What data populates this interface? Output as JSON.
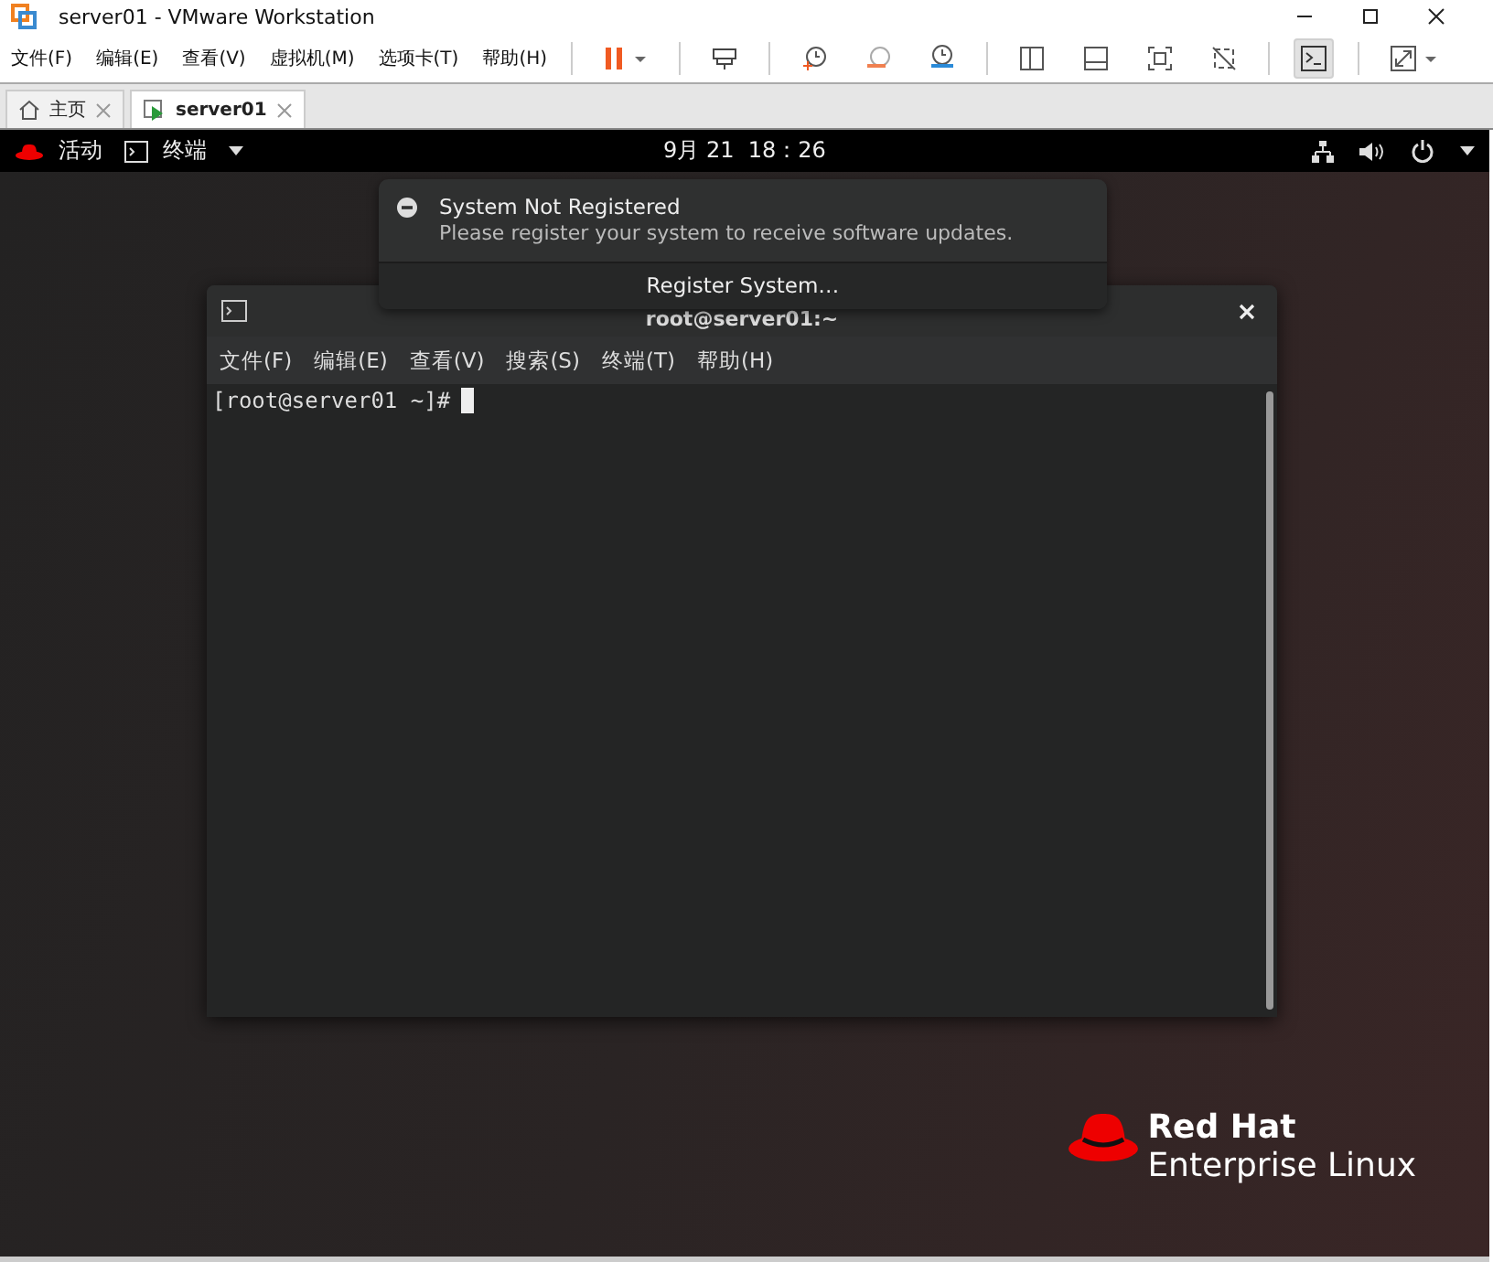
{
  "window": {
    "title": "server01 - VMware Workstation"
  },
  "menu": [
    "文件(F)",
    "编辑(E)",
    "查看(V)",
    "虚拟机(M)",
    "选项卡(T)",
    "帮助(H)"
  ],
  "toolbar": [
    {
      "kind": "pause",
      "selected": false
    },
    {
      "kind": "send-keys",
      "selected": false
    },
    {
      "kind": "snapshot",
      "selected": false
    },
    {
      "kind": "revert",
      "selected": false
    },
    {
      "kind": "manage",
      "selected": false
    },
    {
      "kind": "sidebar",
      "selected": false
    },
    {
      "kind": "thumbnail",
      "selected": false
    },
    {
      "kind": "fit",
      "selected": false
    },
    {
      "kind": "nofit",
      "selected": false
    },
    {
      "kind": "console",
      "selected": true
    },
    {
      "kind": "fullscreen",
      "selected": false
    }
  ],
  "tabs": [
    {
      "label": "主页",
      "kind": "home",
      "selected": false
    },
    {
      "label": "server01",
      "kind": "vm",
      "selected": true
    }
  ],
  "gnome_bar": {
    "activities": "活动",
    "app": "终端",
    "clock": "9月 21  18：26"
  },
  "notification": {
    "title": "System Not Registered",
    "body": "Please register your system to receive software updates.",
    "action": "Register System…"
  },
  "terminal": {
    "title": "root@server01:~",
    "menu": [
      "文件(F)",
      "编辑(E)",
      "查看(V)",
      "搜索(S)",
      "终端(T)",
      "帮助(H)"
    ],
    "prompt": "[root@server01 ~]#"
  },
  "logo": {
    "line1": "Red Hat",
    "line2": "Enterprise Linux"
  }
}
